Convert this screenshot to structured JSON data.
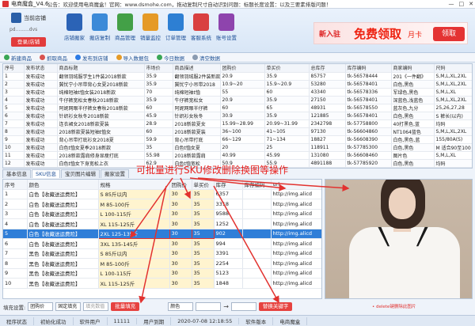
{
  "titlebar": {
    "title": "电商魔盒_V4.6",
    "notice": "公告：欢迎使用电商魔盒！官网：www.dsmohe.com，拖动复制尺寸自动识别问题：标题长度设置：以及三要素排版问题！",
    "minimize": "—",
    "maximize": "□",
    "close": "✕"
  },
  "store": {
    "title": "当前店铺",
    "name": "pd.........dvs",
    "login_button": "登录/店铺"
  },
  "nav": [
    {
      "label": "店铺搬家",
      "color": "#2b63b6"
    },
    {
      "label": "搬店复制",
      "color": "#3b8ad8"
    },
    {
      "label": "商品管理",
      "color": "#43a047"
    },
    {
      "label": "销量监控",
      "color": "#e59a26"
    },
    {
      "label": "订单管理",
      "color": "#2d7fd3"
    },
    {
      "label": "客服系统",
      "color": "#d94040"
    },
    {
      "label": "账号设置",
      "color": "#8e44ad"
    }
  ],
  "ad": {
    "prefix": "新入驻",
    "headline": "免费领取",
    "suffix": "月卡",
    "button": "领取"
  },
  "toolbar": [
    {
      "label": "新建商品",
      "color": "#3aa655"
    },
    {
      "label": "抓取商品",
      "color": "#d9534f"
    },
    {
      "label": "发布到店铺",
      "color": "#2c7be5"
    },
    {
      "label": "导入数据包",
      "color": "#e59a26"
    },
    {
      "label": "今日数据",
      "color": "#3aa655"
    },
    {
      "label": "清空数据",
      "color": "#8a9bb1"
    }
  ],
  "products": {
    "headers": [
      "序号",
      "发布状态",
      "商品标题",
      "市场价",
      "商品描述",
      "团购价",
      "单买价",
      "总库存",
      "库存编码",
      "商家编码",
      "尺码"
    ],
    "rows": [
      [
        "1",
        "发布成功",
        "翻领羽绒服学生1件装2018新款",
        "35.9",
        "翻领羽绒服2件装新款",
        "20.9",
        "35.9",
        "85757",
        "tk-56578444",
        "201《一件翻》",
        "S,M,L,XL,2XL"
      ],
      [
        "2",
        "发布成功",
        "冀忧宁小吊带背心女夏2018新款",
        "35.9",
        "冀忧宁小吊带2018",
        "10.9~20",
        "15.9~20.9",
        "53280",
        "tk-56578401",
        "白色,黑色",
        "S,M,L,XL,2XL"
      ],
      [
        "3",
        "发布成功",
        "纯棉短袖t恤女装2018新款",
        "70",
        "纯棉短袖t恤",
        "55",
        "60",
        "43340",
        "tk-56578336",
        "军绿色,黑色",
        "S,M,L,XL"
      ],
      [
        "4",
        "发布成功",
        "牛仔裤宽松女春秋2018新款",
        "35.9",
        "牛仔裤宽松女",
        "20.9",
        "35.9",
        "27150",
        "tk-56578401",
        "深蓝色,浅蓝色",
        "S,M,L,XL,2XL"
      ],
      [
        "5",
        "发布成功",
        "阿妮网眼半仔裤女春秋2018新款",
        "60",
        "阿妮网眼半仔裤",
        "60",
        "65",
        "48931",
        "tk-56578550",
        "蓝灰色,九分",
        "25,26,27,28"
      ],
      [
        "6",
        "发布成功",
        "针织衫女秋冬2018新款",
        "45.9",
        "针织衫女秋冬",
        "30.9",
        "35.9",
        "121885",
        "tk-56578401",
        "白色,黑色",
        "S 裤长(以内)"
      ],
      [
        "7",
        "发布成功",
        "连衣裙女2018新款夏装",
        "28.9",
        "2018新款夏女",
        "15.99~28.99",
        "20.99~31.99",
        "2342798",
        "tk-57758800",
        "40打黑色,蓝",
        "均码"
      ],
      [
        "8",
        "发布成功",
        "2018新款夏装短袖t恤女",
        "60",
        "2018新款夏装",
        "36~100",
        "41~105",
        "97130",
        "tk-56604860",
        "NT1064蓝色",
        "S,M,L,XL,2XL"
      ],
      [
        "9",
        "发布成功",
        "背心吊带打底衫女2018夏",
        "59.9",
        "背心吊带打底",
        "66~129",
        "71~134",
        "18827",
        "tk-56608390",
        "白色,黑色,蓝",
        "155/80A(S)"
      ],
      [
        "10",
        "发布成功",
        "白色t恤女夏季2018新款",
        "35",
        "白色t恤女夏",
        "20",
        "25",
        "118911",
        "tk-57785300",
        "白色,黑色",
        "M 适合90至100"
      ],
      [
        "11",
        "发布成功",
        "2018新款露肩修身显瘦打底",
        "55.98",
        "2018新款露肩",
        "40.99",
        "45.99",
        "131080",
        "tk-56608460",
        "图片色",
        "S,M,L,XL"
      ],
      [
        "12",
        "发布成功",
        "白色t恤女下身宽松上衣",
        "62.9",
        "白色t恤宽松",
        "50.9",
        "55.9",
        "4891188",
        "tk-57785920",
        "白色,黑色",
        "均码"
      ]
    ]
  },
  "tabs": [
    "基本信息",
    "SKU信息",
    "宝贝图片编辑",
    "搬家设置"
  ],
  "annotation": "可批量进行SKU修改删除换图等操作",
  "sku": {
    "headers": [
      "序号",
      "颜色",
      "规格",
      "团购价",
      "单买价",
      "库存",
      "库存编码",
      "url"
    ],
    "rows": [
      [
        "1",
        "白色【收藏送运费险】",
        "S 85斤以内",
        "30",
        "35",
        "6357",
        "",
        "http://img.alicd"
      ],
      [
        "2",
        "白色【收藏送运费险】",
        "M 85-100斤",
        "30",
        "35",
        "3318",
        "",
        "http://img.alicd"
      ],
      [
        "3",
        "白色【收藏送运费险】",
        "L 100-115斤",
        "30",
        "35",
        "9588",
        "",
        "http://img.alicd"
      ],
      [
        "4",
        "白色【收藏送运费险】",
        "XL 115-125斤",
        "30",
        "35",
        "1252",
        "",
        "http://img.alicd"
      ],
      [
        "5",
        "白色【收藏送运费险】",
        "2XL 125-135斤",
        "30",
        "35",
        "902",
        "",
        "http://img.alicd"
      ],
      [
        "6",
        "白色【收藏送运费险】",
        "3XL 135-145斤",
        "30",
        "35",
        "994",
        "",
        "http://img.alicd"
      ],
      [
        "7",
        "黑色【收藏送运费险】",
        "S 85斤以内",
        "30",
        "35",
        "3391",
        "",
        "http://img.alicd"
      ],
      [
        "8",
        "黑色【收藏送运费险】",
        "M 85-100斤",
        "30",
        "35",
        "2254",
        "",
        "http://img.alicd"
      ],
      [
        "9",
        "黑色【收藏送运费险】",
        "L 100-115斤",
        "30",
        "35",
        "5123",
        "",
        "http://img.alicd"
      ],
      [
        "10",
        "黑色【收藏送运费险】",
        "XL 115-125斤",
        "30",
        "35",
        "1848",
        "",
        "http://img.alicd"
      ]
    ]
  },
  "bottom": {
    "fill_label": "填充设置:",
    "fill_select1": "团购价",
    "fill_select2": "固定填充",
    "fill_input_placeholder": "填充数值",
    "fill_button": "批量填充",
    "color_select": "颜色",
    "arrow": "→",
    "replace_button": "替换关键字",
    "delete_note": "• delete键删除此图片"
  },
  "status": [
    "程序状态",
    "初始化成功",
    "软件用户",
    "11111",
    "用户到期",
    "2020-07-08 12:18:55",
    "软件版本",
    "电商魔盒"
  ]
}
